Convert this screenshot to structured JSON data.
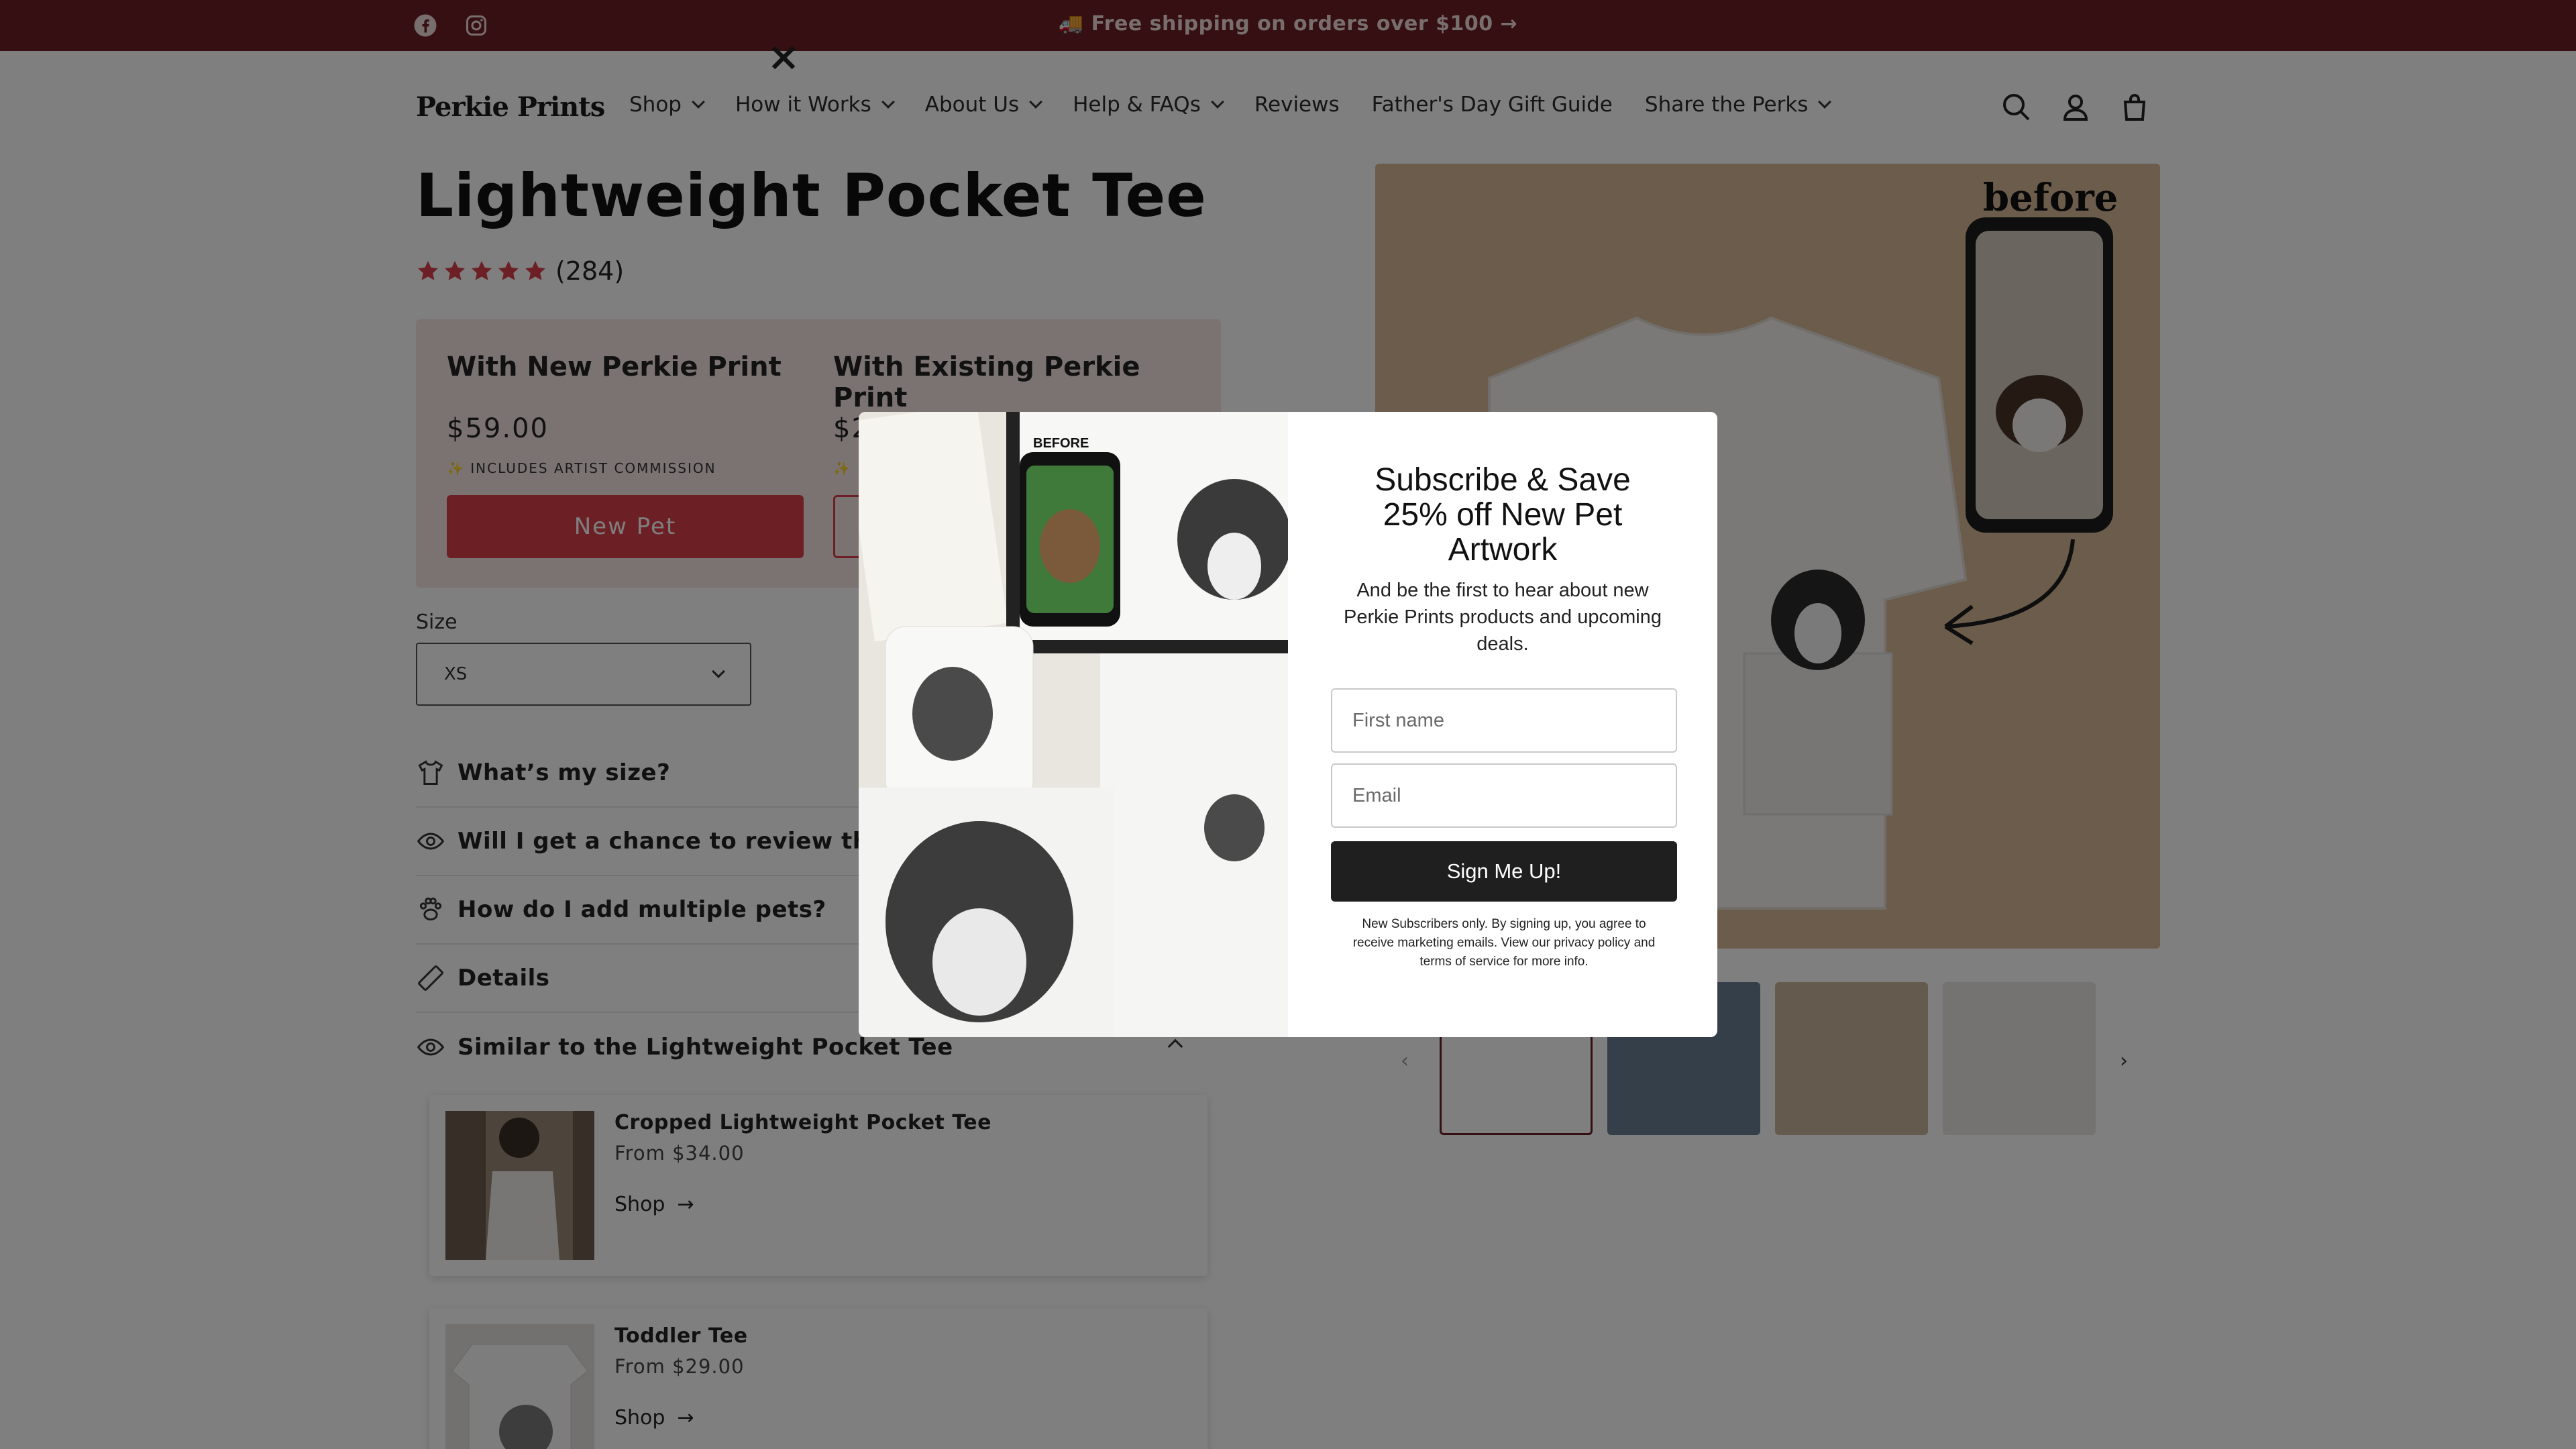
{
  "announcement": {
    "message": "🚚 Free shipping on orders over $100 →",
    "social_icons": [
      "facebook-icon",
      "instagram-icon"
    ]
  },
  "header": {
    "logo": "Perkie Prints",
    "nav": [
      {
        "label": "Shop",
        "has_dropdown": true
      },
      {
        "label": "How it Works",
        "has_dropdown": true
      },
      {
        "label": "About Us",
        "has_dropdown": true
      },
      {
        "label": "Help & FAQs",
        "has_dropdown": true
      },
      {
        "label": "Reviews",
        "has_dropdown": false
      },
      {
        "label": "Father's Day Gift Guide",
        "has_dropdown": false
      },
      {
        "label": "Share the Perks",
        "has_dropdown": true
      }
    ],
    "icons": [
      "search-icon",
      "account-icon",
      "cart-icon"
    ]
  },
  "product": {
    "title": "Lightweight Pocket Tee",
    "rating_stars": 5,
    "review_count": "(284)",
    "options": [
      {
        "title": "With New Perkie Print",
        "price": "$59.00",
        "note": "✨ INCLUDES ARTIST COMMISSION",
        "button": "New Pet"
      },
      {
        "title": "With Existing Perkie Print",
        "price": "$2",
        "note": "✨",
        "button": ""
      }
    ],
    "size_label": "Size",
    "size_value": "XS",
    "accordions": [
      {
        "label": "What’s my size?",
        "icon": "tshirt-icon"
      },
      {
        "label": "Will I get a chance to review the artw",
        "icon": "eye-icon"
      },
      {
        "label": "How do I add multiple pets?",
        "icon": "paw-icon"
      },
      {
        "label": "Details",
        "icon": "ruler-icon"
      },
      {
        "label": "Similar to the Lightweight Pocket Tee",
        "icon": "eye-icon",
        "expanded": true
      }
    ],
    "similar": [
      {
        "name": "Cropped Lightweight Pocket Tee",
        "price": "From $34.00",
        "cta": "Shop"
      },
      {
        "name": "Toddler Tee",
        "price": "From $29.00",
        "cta": "Shop"
      }
    ]
  },
  "gallery": {
    "hero_label": "before",
    "thumbnail_count": 5
  },
  "modal": {
    "headline": "Subscribe & Save 25% off New Pet Artwork",
    "subtext": "And be the first to hear about new Perkie Prints products and upcoming deals.",
    "first_name_placeholder": "First name",
    "email_placeholder": "Email",
    "button": "Sign Me Up!",
    "fineprint": "New Subscribers only. By signing up, you agree to receive marketing emails. View our privacy policy and terms of service for more info.",
    "image_label": "BEFORE"
  },
  "colors": {
    "announcement_bg": "#6b1e22",
    "accent": "#d9414a",
    "price_box_bg": "#f6e4e4",
    "star": "#d9414a",
    "hero_bg": "#d9b998"
  }
}
